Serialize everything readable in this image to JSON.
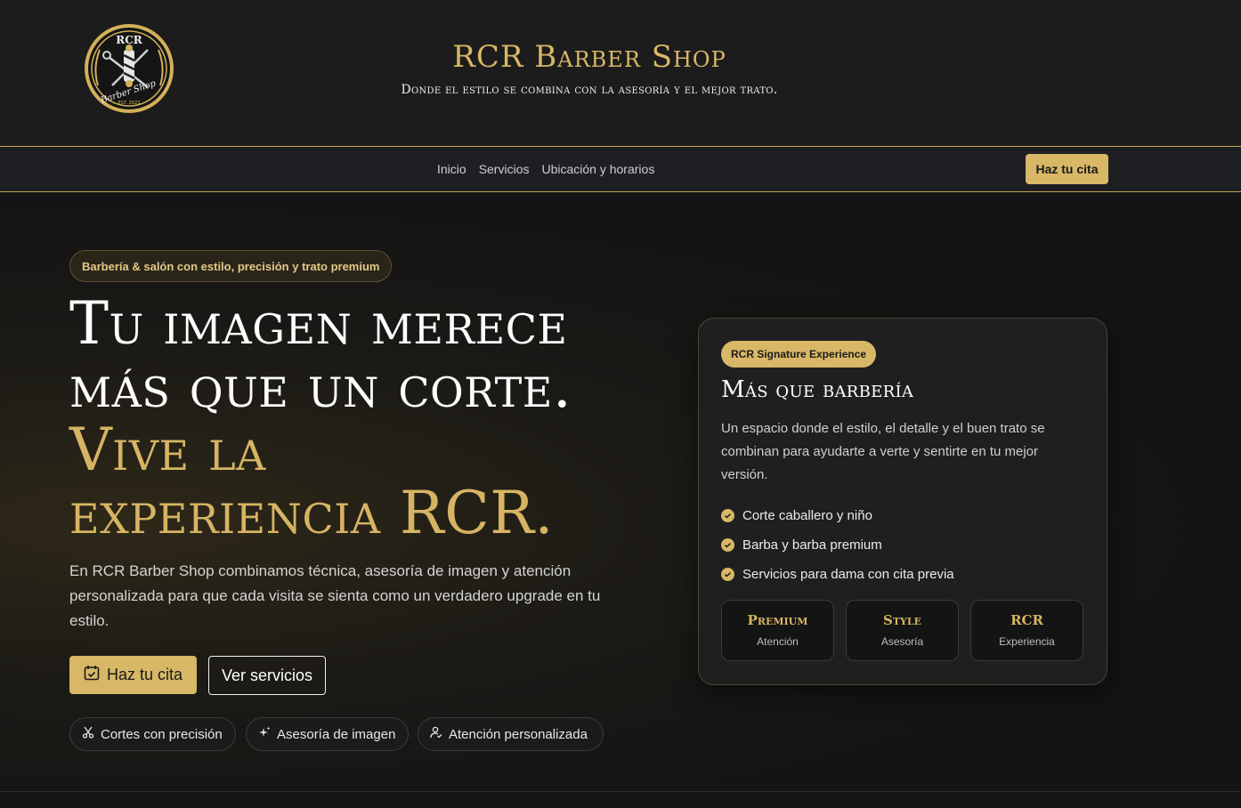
{
  "header": {
    "logo_text_top": "RCR",
    "logo_text_bottom": "Barber Shop",
    "logo_est": "EST. 2023",
    "title": "RCR Barber Shop",
    "tagline": "Donde el estilo se combina con la asesoría y el mejor trato."
  },
  "nav": {
    "links": [
      "Inicio",
      "Servicios",
      "Ubicación y horarios"
    ],
    "cta": "Haz tu cita"
  },
  "hero": {
    "eyebrow": "Barbería & salón con estilo, precisión y trato premium",
    "headline_line1": "Tu imagen merece",
    "headline_line2": "más que un corte.",
    "headline_gold_line1": "Vive la",
    "headline_gold_line2": "experiencia RCR.",
    "description": "En RCR Barber Shop combinamos técnica, asesoría de imagen y atención personalizada para que cada visita se sienta como un verdadero upgrade en tu estilo.",
    "primary_button": "Haz tu cita",
    "secondary_button": "Ver servicios",
    "chips": [
      "Cortes con precisión",
      "Asesoría de imagen",
      "Atención personalizada"
    ]
  },
  "card": {
    "badge": "RCR Signature Experience",
    "title": "Más que barbería",
    "description": "Un espacio donde el estilo, el detalle y el buen trato se combinan para ayudarte a verte y sentirte en tu mejor versión.",
    "features": [
      "Corte caballero y niño",
      "Barba y barba premium",
      "Servicios para dama con cita previa"
    ],
    "stats": [
      {
        "title": "Premium",
        "subtitle": "Atención"
      },
      {
        "title": "Style",
        "subtitle": "Asesoría"
      },
      {
        "title": "RCR",
        "subtitle": "Experiencia"
      }
    ]
  },
  "colors": {
    "accent_gold": "#d8b766",
    "background": "#161616",
    "header_bg": "#1c1c1c",
    "nav_bg": "#1d1f23"
  }
}
